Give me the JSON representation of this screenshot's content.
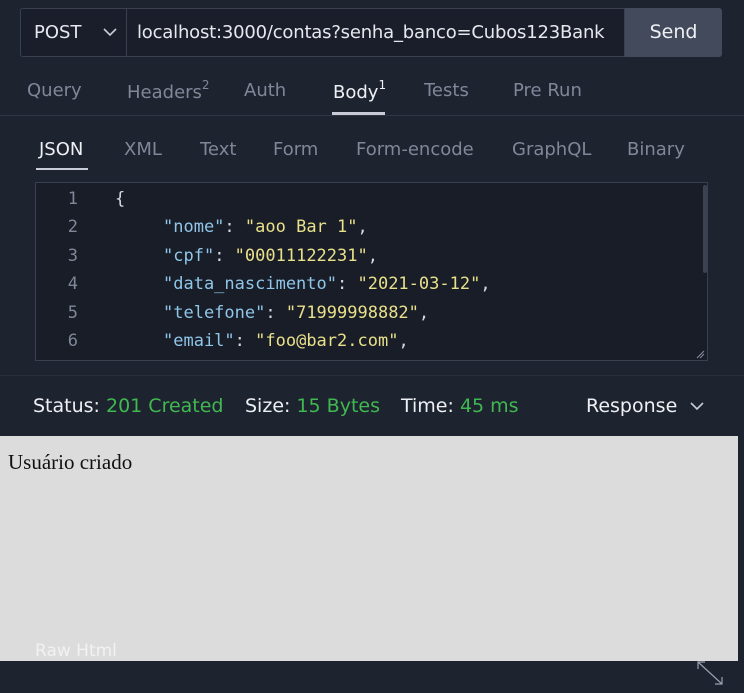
{
  "request": {
    "method": "POST",
    "url": "localhost:3000/contas?senha_banco=Cubos123Bank",
    "send_label": "Send"
  },
  "tabs": [
    {
      "label": "Query",
      "count": ""
    },
    {
      "label": "Headers",
      "count": "2"
    },
    {
      "label": "Auth",
      "count": ""
    },
    {
      "label": "Body",
      "count": "1"
    },
    {
      "label": "Tests",
      "count": ""
    },
    {
      "label": "Pre Run",
      "count": ""
    }
  ],
  "active_tab": "Body",
  "body_types": [
    "JSON",
    "XML",
    "Text",
    "Form",
    "Form-encode",
    "GraphQL",
    "Binary"
  ],
  "active_body_type": "JSON",
  "editor": {
    "line_numbers": [
      "1",
      "2",
      "3",
      "4",
      "5",
      "6"
    ],
    "open_brace": "{",
    "fields": [
      {
        "key": "\"nome\"",
        "value": "\"aoo Bar 1\""
      },
      {
        "key": "\"cpf\"",
        "value": "\"00011122231\""
      },
      {
        "key": "\"data_nascimento\"",
        "value": "\"2021-03-12\""
      },
      {
        "key": "\"telefone\"",
        "value": "\"71999998882\""
      },
      {
        "key": "\"email\"",
        "value": "\"foo@bar2.com\""
      }
    ]
  },
  "response": {
    "status_label": "Status:",
    "status_value": "201 Created",
    "size_label": "Size:",
    "size_value": "15 Bytes",
    "time_label": "Time:",
    "time_value": "45 ms",
    "view_select": "Response",
    "body_text": "Usuário criado",
    "raw_label": "Raw Html"
  },
  "colors": {
    "background": "#1e2330",
    "status_green": "#3fb950",
    "json_key": "#8fc6e8",
    "json_string": "#e8e08a"
  }
}
